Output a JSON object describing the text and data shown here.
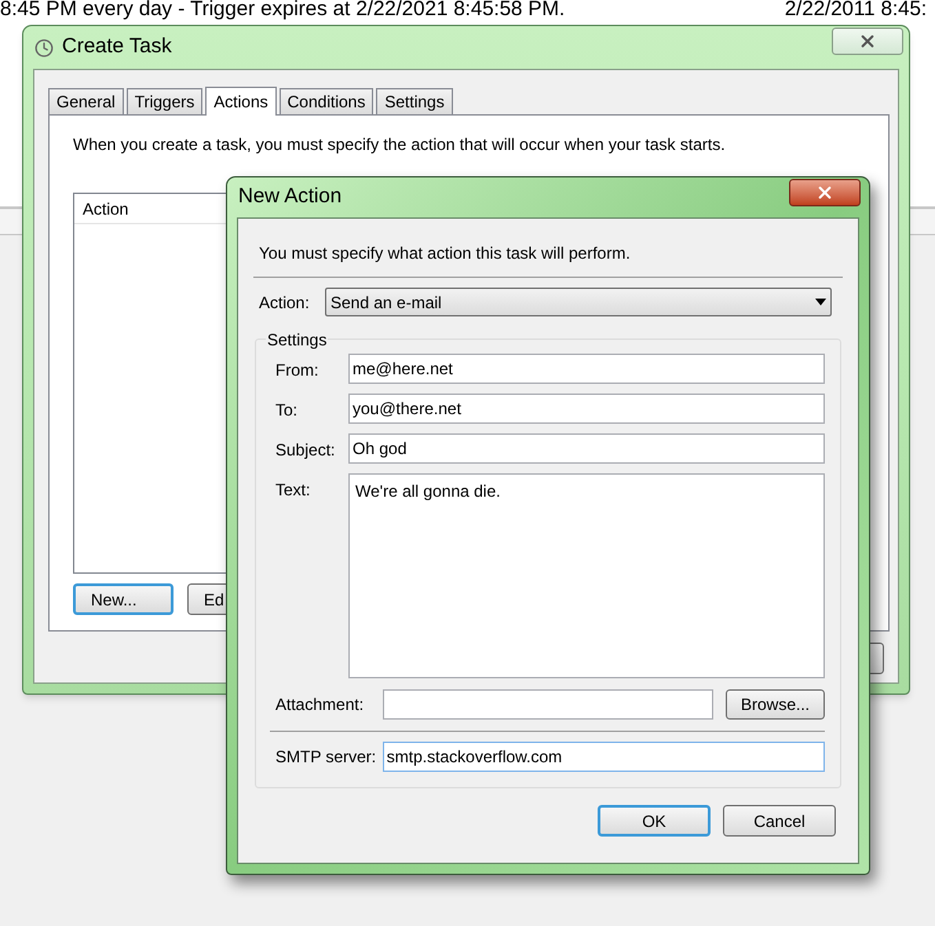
{
  "background": {
    "status_text": "8:45 PM every day - Trigger expires at 2/22/2021 8:45:58 PM.",
    "date_text": "2/22/2011 8:45:"
  },
  "create_task": {
    "title": "Create Task",
    "tabs": [
      {
        "label": "General",
        "selected": false
      },
      {
        "label": "Triggers",
        "selected": false
      },
      {
        "label": "Actions",
        "selected": true
      },
      {
        "label": "Conditions",
        "selected": false
      },
      {
        "label": "Settings",
        "selected": false
      }
    ],
    "description": "When you create a task, you must specify the action that will occur when your task starts.",
    "list": {
      "columns": [
        "Action"
      ]
    },
    "buttons": [
      {
        "label": "New...",
        "default": true
      },
      {
        "label": "Ed",
        "default": false
      }
    ]
  },
  "new_action": {
    "title": "New Action",
    "description": "You must specify what action this task will perform.",
    "action": {
      "label": "Action:",
      "value": "Send an e-mail"
    },
    "settings": {
      "title": "Settings",
      "fields": [
        {
          "label": "From:",
          "value": "me@here.net",
          "kind": "line"
        },
        {
          "label": "To:",
          "value": "you@there.net",
          "kind": "line"
        },
        {
          "label": "Subject:",
          "value": "Oh god",
          "kind": "line"
        },
        {
          "label": "Text:",
          "value": "We're all gonna die.",
          "kind": "area"
        }
      ],
      "attachment": {
        "label": "Attachment:",
        "button": "Browse..."
      },
      "smtp": {
        "label": "SMTP server:",
        "value": "smtp.stackoverflow.com"
      }
    },
    "buttons": [
      {
        "label": "OK",
        "default": true
      },
      {
        "label": "Cancel",
        "default": false
      }
    ]
  }
}
